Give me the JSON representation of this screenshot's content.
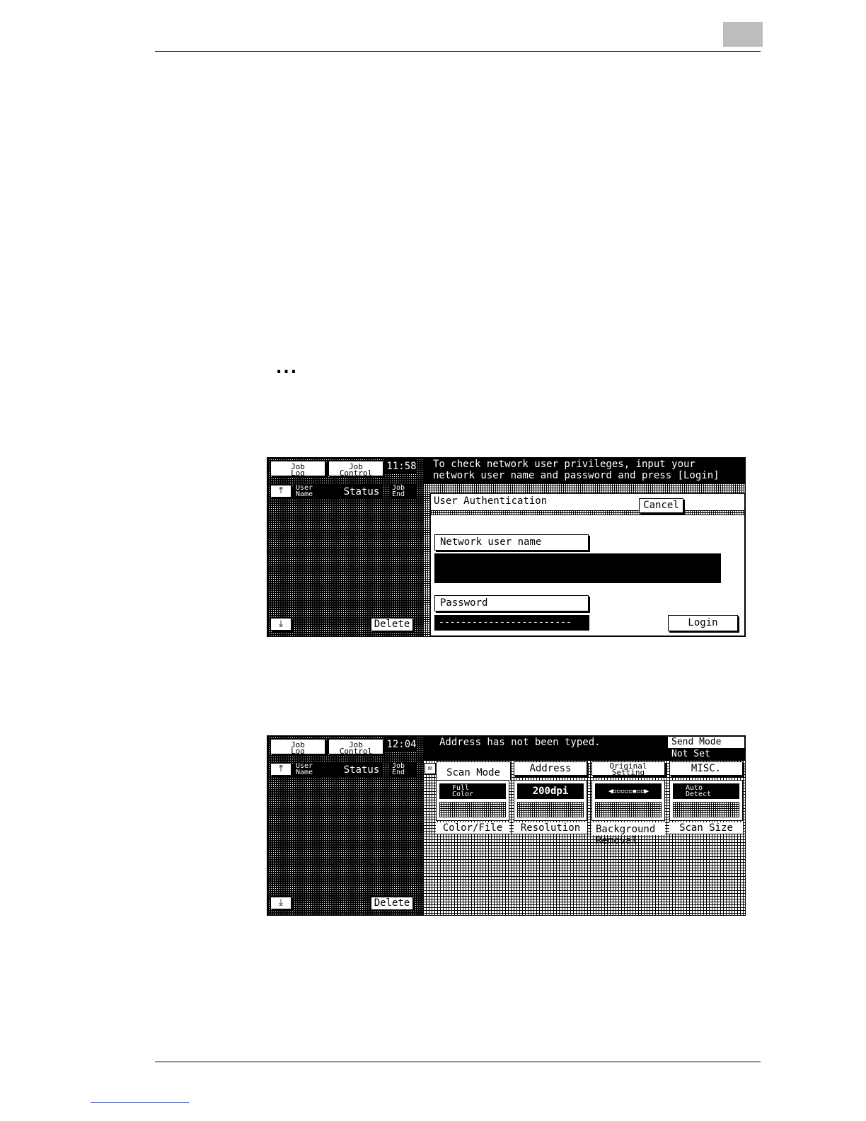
{
  "page": {
    "ellipsis": "..."
  },
  "screen1": {
    "job_log_label": "Job\nLog",
    "job_control_label": "Job\nControl",
    "time": "11:58",
    "message_line1": "To check network user privileges, input your",
    "message_line2": "network user name and password and press [Login]",
    "col_user_name": "User\nName",
    "col_status": "Status",
    "col_job_end": "Job\nEnd",
    "delete_label": "Delete",
    "dialog_title": "User Authentication",
    "cancel_label": "Cancel",
    "network_user_name_label": "Network user name",
    "password_label": "Password",
    "password_mask": "------------------------",
    "login_label": "Login"
  },
  "screen2": {
    "job_log_label": "Job\nLog",
    "job_control_label": "Job\nControl",
    "time": "12:04",
    "message": "Address has not been typed.",
    "send_mode_label": "Send Mode",
    "send_mode_value": "Not Set",
    "col_user_name": "User\nName",
    "col_status": "Status",
    "col_job_end": "Job\nEnd",
    "delete_label": "Delete",
    "tabs": [
      "Scan Mode",
      "Address",
      "Original\nSetting",
      "MISC."
    ],
    "settings": [
      {
        "value": "Full\nColor",
        "caption": "Color/File"
      },
      {
        "value": "200dpi",
        "caption": "Resolution"
      },
      {
        "value": "",
        "caption": "Background\nRemoval"
      },
      {
        "value": "Auto\nDetect",
        "caption": "Scan Size"
      }
    ]
  }
}
